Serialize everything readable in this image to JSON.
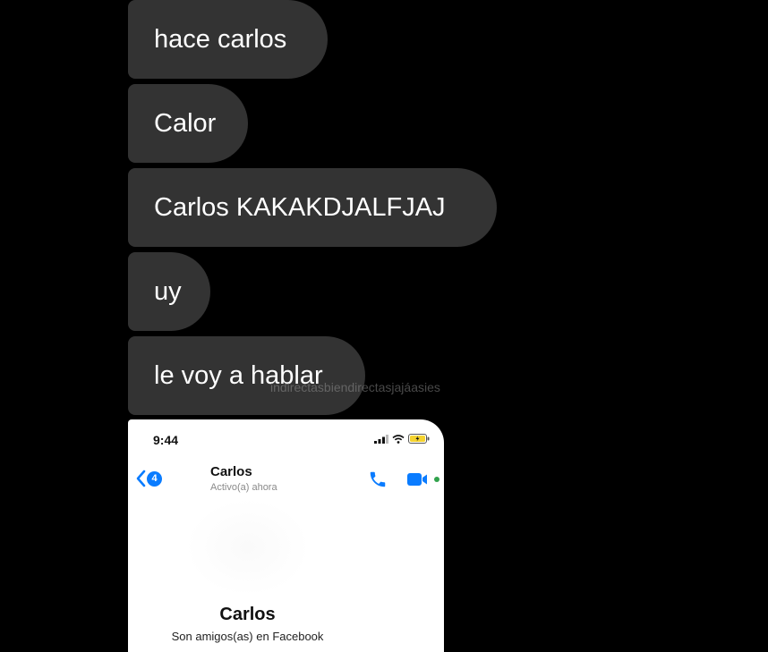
{
  "messages": [
    {
      "text": "hace carlos"
    },
    {
      "text": "Calor"
    },
    {
      "text": "Carlos KAKAKDJALFJAJ"
    },
    {
      "text": "uy"
    },
    {
      "text": "le voy a hablar"
    }
  ],
  "watermark": "indirectasbiendirectasjajáasies",
  "screenshot": {
    "status_time": "9:44",
    "back_badge": "4",
    "contact_name": "Carlos",
    "contact_status": "Activo(a) ahora",
    "profile_name": "Carlos",
    "profile_subtitle": "Son amigos(as) en Facebook"
  },
  "colors": {
    "background": "#000000",
    "bubble": "#333333",
    "accent_blue": "#0a7cff",
    "online_green": "#31a24c"
  }
}
